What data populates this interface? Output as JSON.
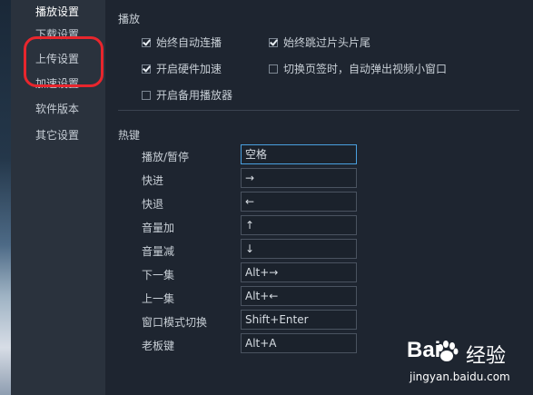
{
  "sidebar": {
    "items": [
      {
        "label": "播放设置",
        "active": true
      },
      {
        "label": "下载设置",
        "active": false
      },
      {
        "label": "上传设置",
        "active": false
      },
      {
        "label": "加速设置",
        "active": false
      },
      {
        "label": "软件版本",
        "active": false
      },
      {
        "label": "其它设置",
        "active": false
      }
    ]
  },
  "playback": {
    "title": "播放",
    "options": [
      {
        "label": "始终自动连播",
        "checked": true
      },
      {
        "label": "始终跳过片头片尾",
        "checked": true
      },
      {
        "label": "开启硬件加速",
        "checked": true
      },
      {
        "label": "切换页签时，自动弹出视频小窗口",
        "checked": false
      },
      {
        "label": "开启备用播放器",
        "checked": false
      }
    ]
  },
  "hotkeys": {
    "title": "热键",
    "rows": [
      {
        "label": "播放/暂停",
        "value": "空格"
      },
      {
        "label": "快进",
        "value": "→"
      },
      {
        "label": "快退",
        "value": "←"
      },
      {
        "label": "音量加",
        "value": "↑"
      },
      {
        "label": "音量减",
        "value": "↓"
      },
      {
        "label": "下一集",
        "value": "Alt+→"
      },
      {
        "label": "上一集",
        "value": "Alt+←"
      },
      {
        "label": "窗口模式切换",
        "value": "Shift+Enter"
      },
      {
        "label": "老板键",
        "value": "Alt+A"
      }
    ]
  },
  "watermark": {
    "brand_left": "Bai",
    "brand_right": "经验",
    "url": "jingyan.baidu.com"
  },
  "colors": {
    "accent_focus": "#4aa0e0",
    "annotation_red": "#e8262d",
    "background": "#1e2530",
    "sidebar": "#2a323d"
  }
}
